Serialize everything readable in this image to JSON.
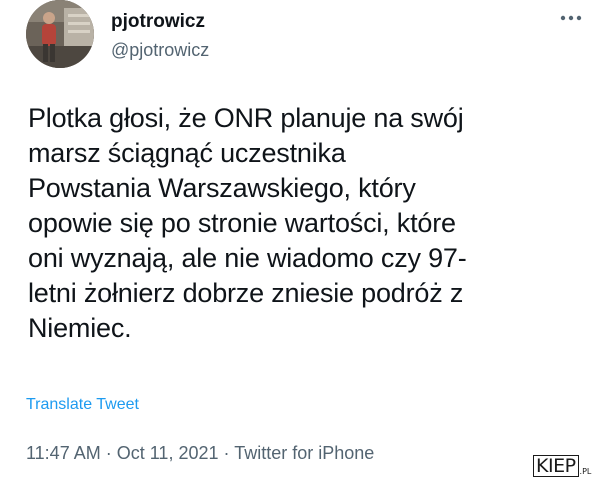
{
  "author": {
    "display_name": "pjotrowicz",
    "handle": "@pjotrowicz",
    "avatar_icon": "profile-photo-icon"
  },
  "more_icon": "more-horizontal-icon",
  "tweet": {
    "text": "Plotka głosi, że ONR planuje na swój\nmarsz ściągnąć uczestnika\nPowstania Warszawskiego, który\nopowie się po stronie wartości, które\noni wyznają, ale nie wiadomo czy 97-\nletni żołnierz dobrze zniesie podróż z\nNiemiec.",
    "translate_label": "Translate Tweet"
  },
  "meta": {
    "time": "11:47 AM",
    "date": "Oct 11, 2021",
    "source": "Twitter for iPhone",
    "separator": "·"
  },
  "watermark": {
    "text": "KIEP",
    "suffix": ".PL"
  },
  "colors": {
    "text": "#0f1419",
    "secondary": "#536471",
    "link": "#1d9bf0",
    "background": "#ffffff"
  }
}
